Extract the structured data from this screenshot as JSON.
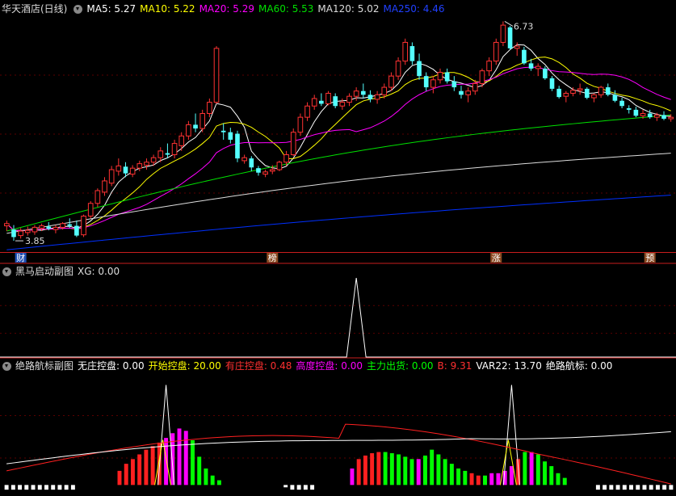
{
  "colors": {
    "bg": "#000000",
    "up": "#ff3232",
    "down": "#54ffff",
    "divider": "#c81e1e",
    "ma5": "#ffffff",
    "ma10": "#ffff00",
    "ma20": "#ff00ff",
    "ma60": "#00e000",
    "ma120": "#dcdcdc",
    "ma250": "#0030ff",
    "wuzhuang": "#ffffff",
    "kaishi": "#ffff00",
    "youzhuang": "#ff2020",
    "gaodu": "#ff00ff",
    "zhuli": "#00ff00",
    "b": "#ff2020",
    "var22": "#ffffff",
    "juelu": "#ffffff"
  },
  "panel1": {
    "title": "华天酒店(日线)",
    "legend": [
      {
        "label": "MA5:",
        "value": "5.27",
        "color": "#ffffff"
      },
      {
        "label": "MA10:",
        "value": "5.22",
        "color": "#ffff00"
      },
      {
        "label": "MA20:",
        "value": "5.29",
        "color": "#ff00ff"
      },
      {
        "label": "MA60:",
        "value": "5.53",
        "color": "#00e000"
      },
      {
        "label": "MA120:",
        "value": "5.02",
        "color": "#dcdcdc"
      },
      {
        "label": "MA250:",
        "value": "4.46",
        "color": "#2040ff"
      }
    ],
    "high_label": "6.73",
    "low_label": "3.85",
    "markers": [
      "财",
      "榜",
      "涨",
      "预"
    ]
  },
  "panel2": {
    "title": "黑马启动副图",
    "legend": [
      {
        "label": "XG:",
        "value": "0.00",
        "color": "#dddddd"
      }
    ]
  },
  "panel3": {
    "title": "绝路航标副图",
    "legend": [
      {
        "label": "无庄控盘:",
        "value": "0.00",
        "color": "#ffffff"
      },
      {
        "label": "开始控盘:",
        "value": "20.00",
        "color": "#ffff00"
      },
      {
        "label": "有庄控盘:",
        "value": "0.48",
        "color": "#ff3030"
      },
      {
        "label": "高度控盘:",
        "value": "0.00",
        "color": "#ff00ff"
      },
      {
        "label": "主力出货:",
        "value": "0.00",
        "color": "#00ff00"
      },
      {
        "label": "B:",
        "value": "9.31",
        "color": "#ff3030"
      },
      {
        "label": "VAR22:",
        "value": "13.70",
        "color": "#ffffff"
      },
      {
        "label": "绝路航标:",
        "value": "0.00",
        "color": "#ffffff"
      }
    ]
  },
  "chart_data": [
    {
      "type": "candlestick",
      "ylim": [
        3.7,
        6.85
      ],
      "candles": [
        [
          4.05,
          4.12,
          3.98,
          4.08
        ],
        [
          4.0,
          4.06,
          3.85,
          3.9
        ],
        [
          3.92,
          4.02,
          3.88,
          3.98
        ],
        [
          3.96,
          4.04,
          3.92,
          3.99
        ],
        [
          3.97,
          4.06,
          3.93,
          4.03
        ],
        [
          4.02,
          4.08,
          3.98,
          4.05
        ],
        [
          4.04,
          4.1,
          3.99,
          4.01
        ],
        [
          4.0,
          4.06,
          3.95,
          4.03
        ],
        [
          4.03,
          4.1,
          4.0,
          4.08
        ],
        [
          4.07,
          4.15,
          4.02,
          4.05
        ],
        [
          4.05,
          4.12,
          3.9,
          3.92
        ],
        [
          3.93,
          4.2,
          3.9,
          4.18
        ],
        [
          4.18,
          4.38,
          4.15,
          4.35
        ],
        [
          4.35,
          4.55,
          4.3,
          4.52
        ],
        [
          4.5,
          4.7,
          4.45,
          4.65
        ],
        [
          4.62,
          4.85,
          4.58,
          4.8
        ],
        [
          4.78,
          4.95,
          4.72,
          4.85
        ],
        [
          4.84,
          4.9,
          4.7,
          4.75
        ],
        [
          4.74,
          4.86,
          4.7,
          4.82
        ],
        [
          4.82,
          4.92,
          4.78,
          4.88
        ],
        [
          4.86,
          4.95,
          4.8,
          4.9
        ],
        [
          4.9,
          5.0,
          4.85,
          4.96
        ],
        [
          4.96,
          5.1,
          4.9,
          5.05
        ],
        [
          5.02,
          5.15,
          4.95,
          5.0
        ],
        [
          5.0,
          5.2,
          4.95,
          5.15
        ],
        [
          5.12,
          5.3,
          5.05,
          5.25
        ],
        [
          5.25,
          5.45,
          5.2,
          5.4
        ],
        [
          5.4,
          5.55,
          5.3,
          5.35
        ],
        [
          5.35,
          5.6,
          5.3,
          5.55
        ],
        [
          5.55,
          5.75,
          5.5,
          5.7
        ],
        [
          5.7,
          6.45,
          5.68,
          6.42
        ],
        [
          5.32,
          5.42,
          5.2,
          5.3
        ],
        [
          5.3,
          5.36,
          5.15,
          5.2
        ],
        [
          5.28,
          5.32,
          4.9,
          4.95
        ],
        [
          4.92,
          5.0,
          4.88,
          4.96
        ],
        [
          4.95,
          4.98,
          4.78,
          4.83
        ],
        [
          4.82,
          4.85,
          4.72,
          4.76
        ],
        [
          4.74,
          4.8,
          4.7,
          4.77
        ],
        [
          4.78,
          4.86,
          4.74,
          4.8
        ],
        [
          4.8,
          4.92,
          4.78,
          4.9
        ],
        [
          4.9,
          5.05,
          4.85,
          5.0
        ],
        [
          5.0,
          5.35,
          4.98,
          5.3
        ],
        [
          5.3,
          5.55,
          5.25,
          5.5
        ],
        [
          5.5,
          5.7,
          5.45,
          5.65
        ],
        [
          5.65,
          5.8,
          5.6,
          5.75
        ],
        [
          5.72,
          5.82,
          5.65,
          5.68
        ],
        [
          5.68,
          5.85,
          5.66,
          5.82
        ],
        [
          5.78,
          5.82,
          5.62,
          5.65
        ],
        [
          5.65,
          5.75,
          5.6,
          5.7
        ],
        [
          5.7,
          5.82,
          5.65,
          5.78
        ],
        [
          5.78,
          5.9,
          5.72,
          5.85
        ],
        [
          5.85,
          5.95,
          5.75,
          5.8
        ],
        [
          5.8,
          5.86,
          5.7,
          5.74
        ],
        [
          5.74,
          5.85,
          5.68,
          5.8
        ],
        [
          5.8,
          5.95,
          5.75,
          5.9
        ],
        [
          5.9,
          6.1,
          5.85,
          6.05
        ],
        [
          6.05,
          6.3,
          6.0,
          6.25
        ],
        [
          6.25,
          6.55,
          6.2,
          6.5
        ],
        [
          6.45,
          6.5,
          6.2,
          6.25
        ],
        [
          6.25,
          6.35,
          6.0,
          6.05
        ],
        [
          6.05,
          6.1,
          5.85,
          5.9
        ],
        [
          5.9,
          6.05,
          5.82,
          6.0
        ],
        [
          6.0,
          6.15,
          5.95,
          6.1
        ],
        [
          6.1,
          6.15,
          5.95,
          5.98
        ],
        [
          5.98,
          6.05,
          5.85,
          5.9
        ],
        [
          5.85,
          5.92,
          5.75,
          5.8
        ],
        [
          5.8,
          5.9,
          5.7,
          5.85
        ],
        [
          5.85,
          6.0,
          5.8,
          5.95
        ],
        [
          5.95,
          6.15,
          5.9,
          6.12
        ],
        [
          6.12,
          6.3,
          6.05,
          6.25
        ],
        [
          6.25,
          6.55,
          6.2,
          6.5
        ],
        [
          6.5,
          6.78,
          6.45,
          6.73
        ],
        [
          6.7,
          6.72,
          6.4,
          6.42
        ],
        [
          6.42,
          6.5,
          6.32,
          6.45
        ],
        [
          6.4,
          6.44,
          6.2,
          6.22
        ],
        [
          6.22,
          6.28,
          6.12,
          6.15
        ],
        [
          6.15,
          6.22,
          6.05,
          6.18
        ],
        [
          6.15,
          6.18,
          6.0,
          6.02
        ],
        [
          6.02,
          6.05,
          5.85,
          5.88
        ],
        [
          5.88,
          5.92,
          5.75,
          5.77
        ],
        [
          5.78,
          5.85,
          5.7,
          5.82
        ],
        [
          5.82,
          5.9,
          5.78,
          5.86
        ],
        [
          5.86,
          5.95,
          5.8,
          5.88
        ],
        [
          5.88,
          5.9,
          5.74,
          5.76
        ],
        [
          5.76,
          5.82,
          5.7,
          5.8
        ],
        [
          5.8,
          5.92,
          5.76,
          5.9
        ],
        [
          5.9,
          5.95,
          5.78,
          5.8
        ],
        [
          5.8,
          5.86,
          5.7,
          5.72
        ],
        [
          5.72,
          5.76,
          5.62,
          5.65
        ],
        [
          5.62,
          5.66,
          5.55,
          5.6
        ],
        [
          5.6,
          5.64,
          5.5,
          5.52
        ],
        [
          5.52,
          5.6,
          5.48,
          5.55
        ],
        [
          5.55,
          5.6,
          5.48,
          5.5
        ],
        [
          5.5,
          5.56,
          5.45,
          5.53
        ],
        [
          5.53,
          5.58,
          5.46,
          5.48
        ],
        [
          5.48,
          5.54,
          5.44,
          5.5
        ]
      ]
    },
    {
      "type": "line",
      "xg_peak_index": 50,
      "xg_peak": 1.0,
      "ylim": [
        0,
        1
      ]
    },
    {
      "type": "bar",
      "ylim": [
        -8,
        95
      ],
      "bars": [
        [
          -4,
          "w"
        ],
        [
          -4,
          "w"
        ],
        [
          -4,
          "w"
        ],
        [
          -4,
          "w"
        ],
        [
          -4,
          "w"
        ],
        [
          -4,
          "w"
        ],
        [
          -4,
          "w"
        ],
        [
          -4,
          "w"
        ],
        [
          -4,
          "w"
        ],
        [
          -4,
          "w"
        ],
        [
          -4,
          "w"
        ],
        [
          0,
          "n"
        ],
        [
          0,
          "n"
        ],
        [
          0,
          "n"
        ],
        [
          0,
          "n"
        ],
        [
          0,
          "n"
        ],
        [
          0,
          "n"
        ],
        [
          12,
          "r"
        ],
        [
          18,
          "r"
        ],
        [
          22,
          "r"
        ],
        [
          26,
          "r"
        ],
        [
          30,
          "r"
        ],
        [
          33,
          "r"
        ],
        [
          36,
          "r"
        ],
        [
          40,
          "m"
        ],
        [
          44,
          "m"
        ],
        [
          48,
          "m"
        ],
        [
          46,
          "m"
        ],
        [
          38,
          "g"
        ],
        [
          24,
          "g"
        ],
        [
          14,
          "g"
        ],
        [
          8,
          "g"
        ],
        [
          4,
          "g"
        ],
        [
          0,
          "n"
        ],
        [
          0,
          "n"
        ],
        [
          0,
          "n"
        ],
        [
          0,
          "n"
        ],
        [
          0,
          "n"
        ],
        [
          0,
          "n"
        ],
        [
          0,
          "n"
        ],
        [
          0,
          "n"
        ],
        [
          0,
          "n"
        ],
        [
          -2,
          "w"
        ],
        [
          -4,
          "w"
        ],
        [
          -4,
          "w"
        ],
        [
          -4,
          "w"
        ],
        [
          -4,
          "w"
        ],
        [
          0,
          "n"
        ],
        [
          0,
          "n"
        ],
        [
          0,
          "n"
        ],
        [
          0,
          "n"
        ],
        [
          0,
          "n"
        ],
        [
          14,
          "m"
        ],
        [
          22,
          "r"
        ],
        [
          25,
          "r"
        ],
        [
          27,
          "r"
        ],
        [
          28,
          "r"
        ],
        [
          28,
          "g"
        ],
        [
          27,
          "g"
        ],
        [
          26,
          "g"
        ],
        [
          24,
          "g"
        ],
        [
          22,
          "g"
        ],
        [
          22,
          "m"
        ],
        [
          25,
          "g"
        ],
        [
          30,
          "g"
        ],
        [
          26,
          "g"
        ],
        [
          22,
          "g"
        ],
        [
          18,
          "g"
        ],
        [
          14,
          "g"
        ],
        [
          12,
          "g"
        ],
        [
          10,
          "r"
        ],
        [
          8,
          "r"
        ],
        [
          8,
          "g"
        ],
        [
          10,
          "m"
        ],
        [
          10,
          "m"
        ],
        [
          12,
          "m"
        ],
        [
          16,
          "m"
        ],
        [
          22,
          "r"
        ],
        [
          28,
          "g"
        ],
        [
          28,
          "m"
        ],
        [
          26,
          "g"
        ],
        [
          20,
          "g"
        ],
        [
          16,
          "g"
        ],
        [
          10,
          "g"
        ],
        [
          6,
          "g"
        ],
        [
          0,
          "n"
        ],
        [
          0,
          "n"
        ],
        [
          0,
          "n"
        ],
        [
          0,
          "n"
        ],
        [
          -4,
          "w"
        ],
        [
          -4,
          "w"
        ],
        [
          -4,
          "w"
        ],
        [
          -4,
          "w"
        ],
        [
          -4,
          "w"
        ],
        [
          -4,
          "w"
        ],
        [
          -4,
          "w"
        ],
        [
          -4,
          "w"
        ],
        [
          -4,
          "w"
        ],
        [
          -4,
          "w"
        ],
        [
          -4,
          "w"
        ],
        [
          -4,
          "w"
        ]
      ],
      "spikes": [
        {
          "index": 24,
          "value": 85
        },
        {
          "index": 76,
          "value": 85
        }
      ]
    }
  ]
}
